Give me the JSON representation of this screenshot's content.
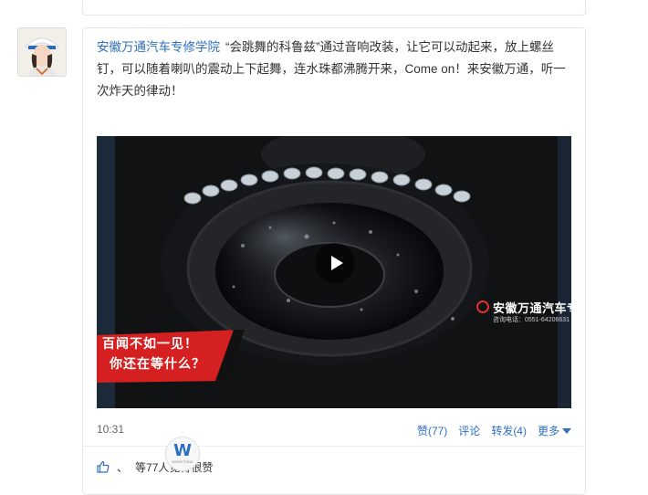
{
  "post": {
    "author": "安徽万通汽车专修学院",
    "text": "“会跳舞的科鲁兹”通过音响改装，让它可以动起来，放上螺丝钉，可以随着喇叭的震动上下起舞，连水珠都沸腾开来，Come on！来安徽万通，听一次炸天的律动！",
    "avatar_icon": "avatar-image"
  },
  "video": {
    "watermark_title": "安徽万通汽车专修学院",
    "watermark_sub": "咨询电话：0551-64206631",
    "banner_line1": "百闻不如一见！",
    "banner_line2": "你还在等什么？",
    "play_icon": "play-icon",
    "colors": {
      "banner_red": "#d42020",
      "background": "#0b0c0e"
    }
  },
  "footer": {
    "time": "10:31",
    "like": "赞(77)",
    "comment": "评论",
    "repost": "转发(4)",
    "more": "更多"
  },
  "likes": {
    "separator": "、",
    "summary": "等77人觉得很赞"
  },
  "overlay_logo": {
    "letter": "W",
    "sub": "WORKTONE"
  },
  "colors": {
    "link": "#2f6fc1",
    "border": "#e6e6e6"
  }
}
